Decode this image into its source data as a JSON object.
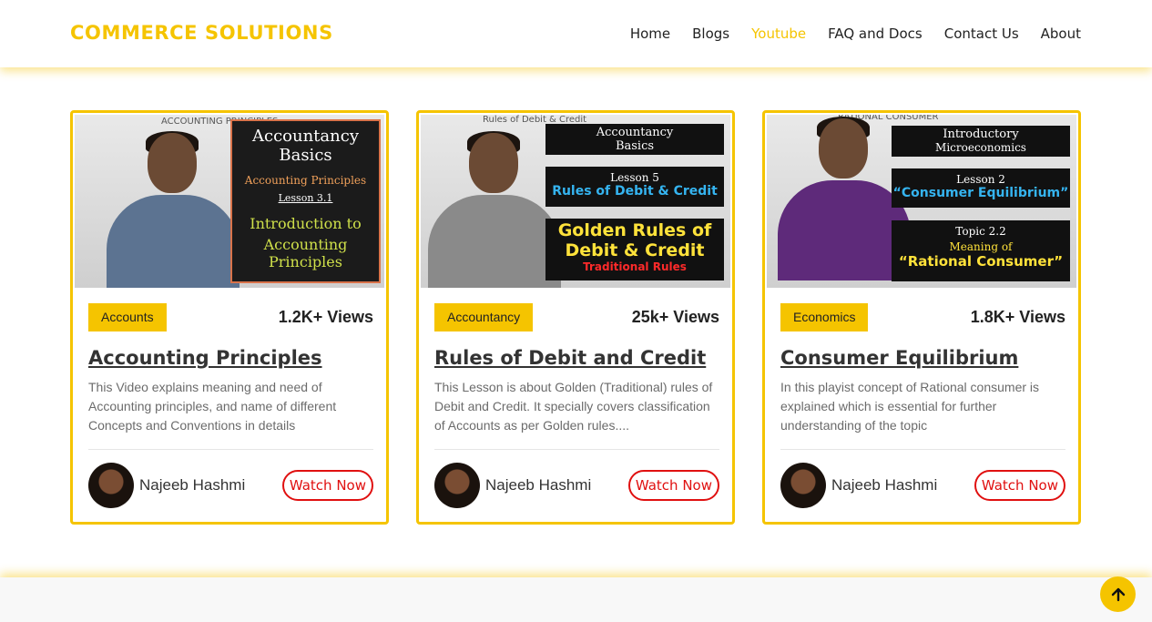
{
  "brand": "COMMERCE SOLUTIONS",
  "nav": [
    "Home",
    "Blogs",
    "Youtube",
    "FAQ and Docs",
    "Contact Us",
    "About"
  ],
  "active_nav": "Youtube",
  "cards": [
    {
      "tag": "Accounts",
      "views": "1.2K+ Views",
      "title": "Accounting Principles",
      "description": "This Video explains meaning and need of Accounting principles, and name of different Concepts and Conventions in details",
      "author": "Najeeb Hashmi",
      "button": "Watch Now",
      "thumb": {
        "board_text": "ACCOUNTING PRINCIPLES",
        "panel_lines": [
          "Accountancy",
          "Basics",
          "Accounting Principles",
          "Lesson 3.1",
          "Introduction to",
          "Accounting Principles"
        ]
      }
    },
    {
      "tag": "Accountancy",
      "views": "25k+ Views",
      "title": "Rules of Debit and Credit",
      "description": "This Lesson is about Golden (Traditional) rules of Debit and Credit. It specially covers classification of Accounts as per Golden rules....",
      "author": "Najeeb Hashmi",
      "button": "Watch Now",
      "thumb": {
        "board_text": "Rules of Debit & Credit",
        "panel_lines": [
          "Accountancy",
          "Basics",
          "Lesson 5",
          "Rules of Debit & Credit",
          "Golden Rules of",
          "Debit & Credit",
          "Traditional Rules"
        ]
      }
    },
    {
      "tag": "Economics",
      "views": "1.8K+ Views",
      "title": "Consumer Equilibrium",
      "description": "In this playist concept of Rational consumer is explained which is essential for further understanding of the topic",
      "author": "Najeeb Hashmi",
      "button": "Watch Now",
      "thumb": {
        "board_text": "RATIONAL CONSUMER",
        "panel_lines": [
          "Introductory",
          "Microeconomics",
          "Lesson 2",
          "“Consumer Equilibrium”",
          "Topic 2.2",
          "Meaning of",
          "“Rational Consumer”"
        ]
      }
    }
  ],
  "back_to_top_icon": "arrow-up-icon"
}
